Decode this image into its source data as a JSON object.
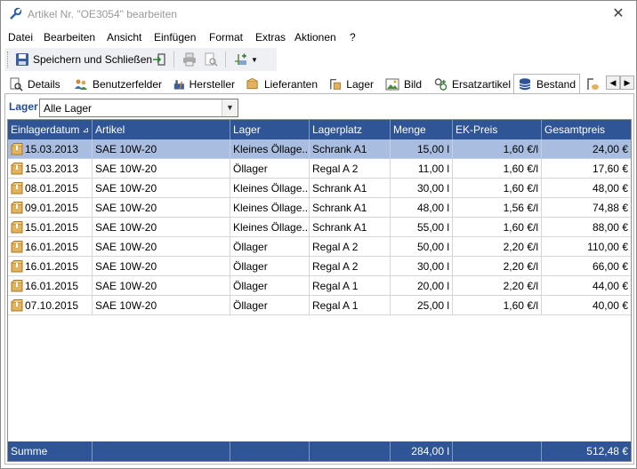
{
  "window": {
    "title": "Artikel Nr. \"OE3054\" bearbeiten",
    "close_label": "✕"
  },
  "menu": {
    "items": [
      "Datei",
      "Bearbeiten",
      "Ansicht",
      "Einfügen",
      "Format",
      "Extras",
      "Aktionen",
      "?"
    ]
  },
  "toolbar": {
    "save_close_label": "Speichern und Schließen",
    "icons": [
      "save-icon",
      "exit-icon",
      "print-icon",
      "print-preview-icon",
      "add-icon"
    ]
  },
  "tabs": {
    "items": [
      "Details",
      "Benutzerfelder",
      "Hersteller",
      "Lieferanten",
      "Lager",
      "Bild",
      "Ersatzartikel",
      "Bestand"
    ],
    "active": "Bestand"
  },
  "filter": {
    "label": "Lager",
    "selected": "Alle Lager"
  },
  "table": {
    "columns": [
      "Einlagerdatum",
      "Artikel",
      "Lager",
      "Lagerplatz",
      "Menge",
      "EK-Preis",
      "Gesamtpreis"
    ],
    "sort_indicator": "⊿",
    "rows": [
      [
        "15.03.2013",
        "SAE 10W-20",
        "Kleines Öllage...",
        "Schrank A1",
        "15,00 l",
        "1,60 €/l",
        "24,00 €"
      ],
      [
        "15.03.2013",
        "SAE 10W-20",
        "Öllager",
        "Regal A 2",
        "11,00 l",
        "1,60 €/l",
        "17,60 €"
      ],
      [
        "08.01.2015",
        "SAE 10W-20",
        "Kleines Öllage...",
        "Schrank A1",
        "30,00 l",
        "1,60 €/l",
        "48,00 €"
      ],
      [
        "09.01.2015",
        "SAE 10W-20",
        "Kleines Öllage...",
        "Schrank A1",
        "48,00 l",
        "1,56 €/l",
        "74,88 €"
      ],
      [
        "15.01.2015",
        "SAE 10W-20",
        "Kleines Öllage...",
        "Schrank A1",
        "55,00 l",
        "1,60 €/l",
        "88,00 €"
      ],
      [
        "16.01.2015",
        "SAE 10W-20",
        "Öllager",
        "Regal A 2",
        "50,00 l",
        "2,20 €/l",
        "110,00 €"
      ],
      [
        "16.01.2015",
        "SAE 10W-20",
        "Öllager",
        "Regal A 2",
        "30,00 l",
        "2,20 €/l",
        "66,00 €"
      ],
      [
        "16.01.2015",
        "SAE 10W-20",
        "Öllager",
        "Regal A 1",
        "20,00 l",
        "2,20 €/l",
        "44,00 €"
      ],
      [
        "07.10.2015",
        "SAE 10W-20",
        "Öllager",
        "Regal A 1",
        "25,00 l",
        "1,60 €/l",
        "40,00 €"
      ]
    ],
    "selected_row": 0
  },
  "summary": {
    "label": "Summe",
    "menge": "284,00 l",
    "gesamtpreis": "512,48 €"
  },
  "colors": {
    "header_bg": "#2f5597",
    "selected_row": "#a9bde0",
    "label_blue": "#1f4e96"
  }
}
